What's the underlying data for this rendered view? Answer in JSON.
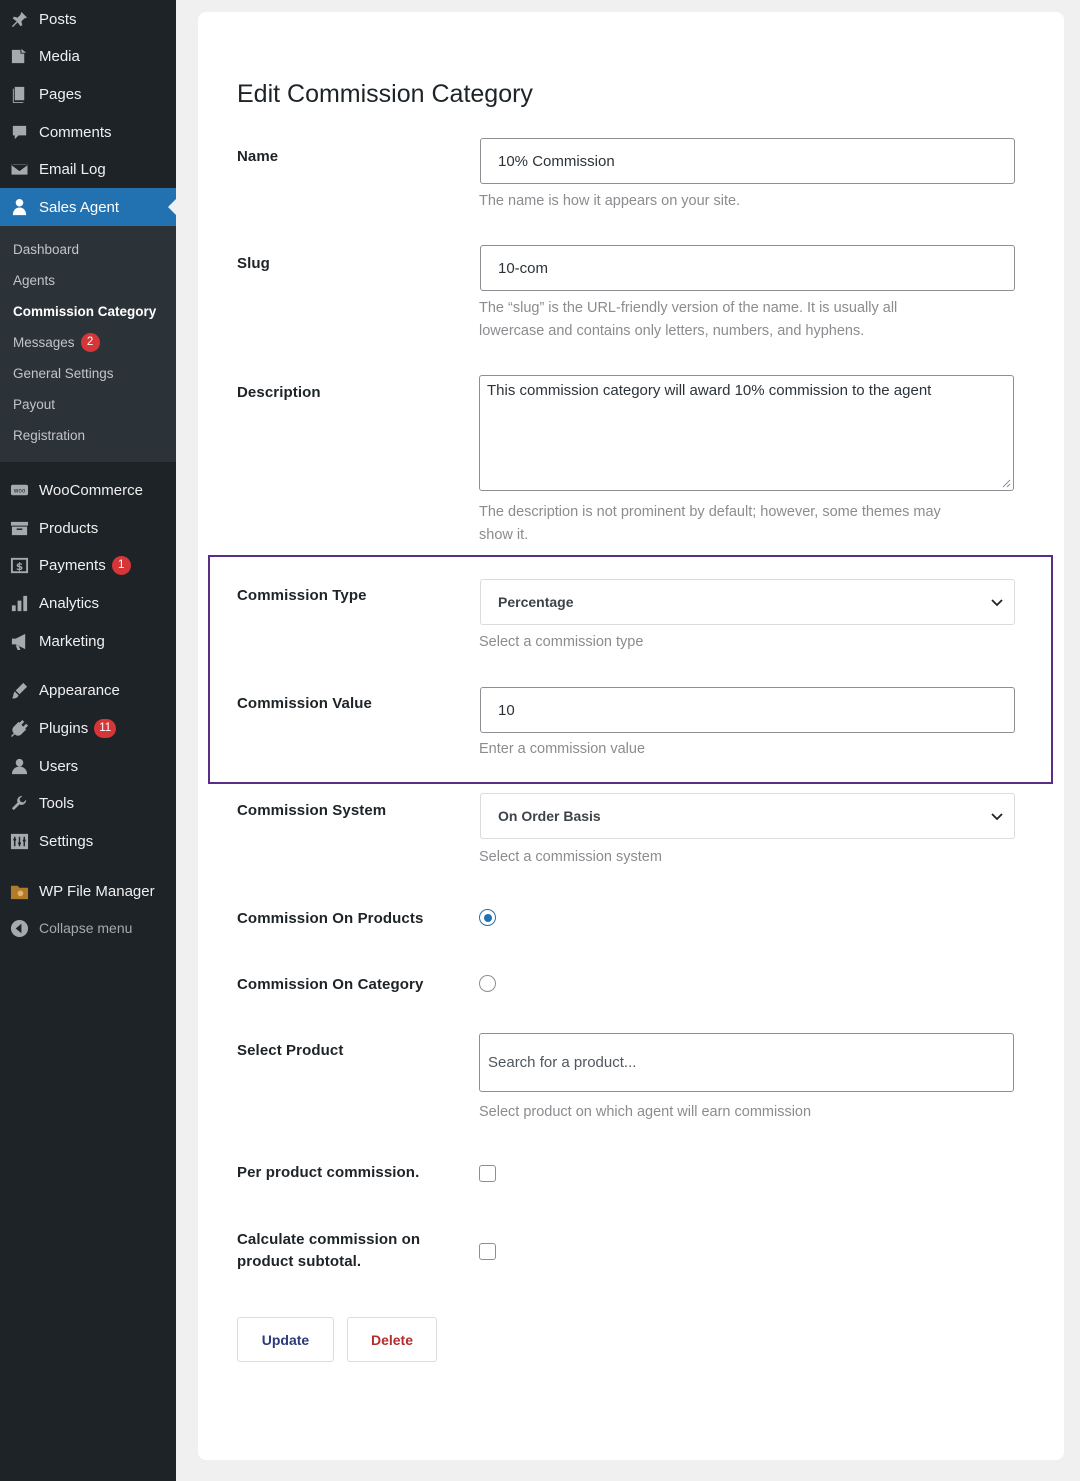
{
  "sidebar": {
    "items": [
      {
        "label": "Posts",
        "icon": "pin-icon"
      },
      {
        "label": "Media",
        "icon": "media-icon"
      },
      {
        "label": "Pages",
        "icon": "pages-icon"
      },
      {
        "label": "Comments",
        "icon": "comments-icon"
      },
      {
        "label": "Email Log",
        "icon": "email-icon"
      },
      {
        "label": "Sales Agent",
        "icon": "user-icon"
      }
    ],
    "submenu": [
      {
        "label": "Dashboard"
      },
      {
        "label": "Agents"
      },
      {
        "label": "Commission Category"
      },
      {
        "label": "Messages",
        "badge": "2"
      },
      {
        "label": "General Settings"
      },
      {
        "label": "Payout"
      },
      {
        "label": "Registration"
      }
    ],
    "items2": [
      {
        "label": "WooCommerce",
        "icon": "woo-icon"
      },
      {
        "label": "Products",
        "icon": "archive-icon"
      },
      {
        "label": "Payments",
        "icon": "dollar-icon",
        "badge": "1"
      },
      {
        "label": "Analytics",
        "icon": "bar-chart-icon"
      },
      {
        "label": "Marketing",
        "icon": "megaphone-icon"
      },
      {
        "label": "Appearance",
        "icon": "brush-icon"
      },
      {
        "label": "Plugins",
        "icon": "plug-icon",
        "badge": "11"
      },
      {
        "label": "Users",
        "icon": "users-icon"
      },
      {
        "label": "Tools",
        "icon": "wrench-icon"
      },
      {
        "label": "Settings",
        "icon": "settings-icon"
      },
      {
        "label": "WP File Manager",
        "icon": "folder-icon"
      }
    ],
    "collapse": "Collapse menu",
    "active_color": "#2271b1"
  },
  "form": {
    "title": "Edit Commission Category",
    "name_label": "Name",
    "name_value": "10% Commission",
    "name_help": "The name is how it appears on your site.",
    "slug_label": "Slug",
    "slug_value": "10-com",
    "slug_help_1": "The “slug” is the URL-friendly version of the name. It is usually all",
    "slug_help_2": "lowercase and contains only letters, numbers, and hyphens.",
    "description_label": "Description",
    "description_value": "This commission category will award 10% commission to the agent",
    "description_help_1": "The description is not prominent by default; however, some themes may",
    "description_help_2": "show it.",
    "commission_type_label": "Commission Type",
    "commission_type_value": "Percentage",
    "commission_type_help": "Select a commission type",
    "commission_value_label": "Commission Value",
    "commission_value": "10",
    "commission_value_help": "Enter a commission value",
    "commission_system_label": "Commission System",
    "commission_system_value": "On Order Basis",
    "commission_system_help": "Select a commission system",
    "commission_on_products_label": "Commission On Products",
    "commission_on_category_label": "Commission On Category",
    "select_product_label": "Select Product",
    "select_product_placeholder": "Search for a product...",
    "select_product_help": "Select product on which agent will earn commission",
    "per_product_label": "Per product commission.",
    "subtotal_label_1": "Calculate commission on",
    "subtotal_label_2": "product subtotal.",
    "update_label": "Update",
    "delete_label": "Delete",
    "highlight_color": "#5b2d86"
  }
}
